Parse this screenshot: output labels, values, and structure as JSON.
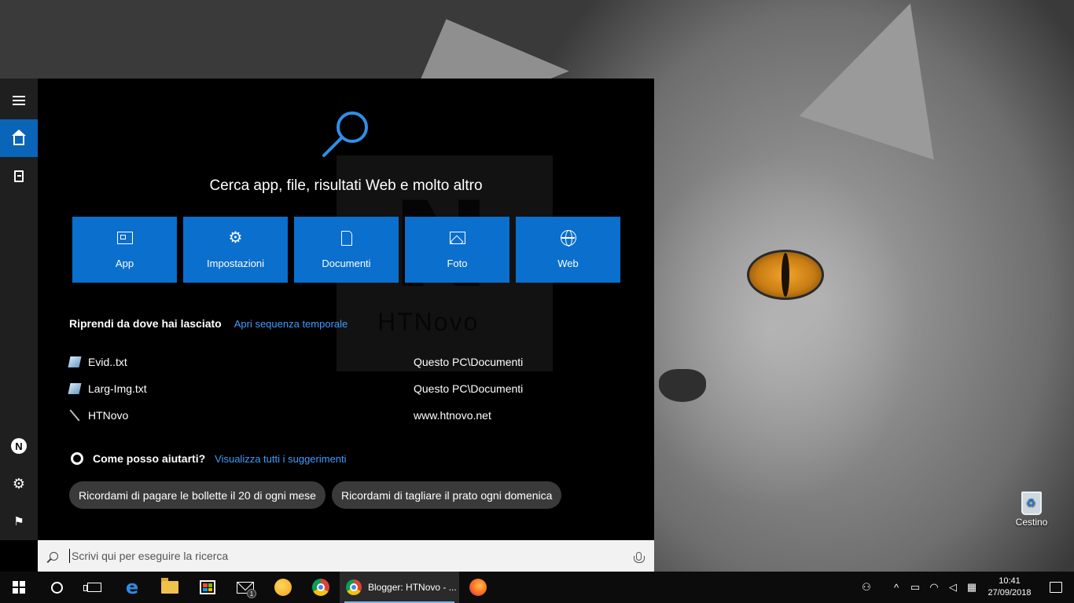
{
  "search": {
    "heading": "Cerca app, file, risultati Web e molto altro",
    "placeholder": "Scrivi qui per eseguire la ricerca"
  },
  "tiles": [
    {
      "label": "App",
      "icon": "app-icon"
    },
    {
      "label": "Impostazioni",
      "icon": "gear-icon"
    },
    {
      "label": "Documenti",
      "icon": "document-icon"
    },
    {
      "label": "Foto",
      "icon": "photo-icon"
    },
    {
      "label": "Web",
      "icon": "globe-icon"
    }
  ],
  "recent": {
    "title": "Riprendi da dove hai lasciato",
    "link": "Apri sequenza temporale",
    "items": [
      {
        "name": "Evid..txt",
        "location": "Questo PC\\Documenti"
      },
      {
        "name": "Larg-Img.txt",
        "location": "Questo PC\\Documenti"
      },
      {
        "name": "HTNovo",
        "location": "www.htnovo.net"
      }
    ]
  },
  "help": {
    "title": "Come posso aiutarti?",
    "link": "Visualizza tutti i suggerimenti",
    "suggestions": [
      "Ricordami di pagare le bollette il 20 di ogni mese",
      "Ricordami di tagliare il prato ogni domenica"
    ]
  },
  "watermark": {
    "letter": "N",
    "text": "HTNovo"
  },
  "rail": {
    "avatar_letter": "N"
  },
  "desktop": {
    "recycle_bin_label": "Cestino"
  },
  "taskbar": {
    "active_window_label": "Blogger: HTNovo - ...",
    "mail_badge": "1",
    "time": "10:41",
    "date": "27/09/2018"
  },
  "colors": {
    "accent": "#0a6fcd",
    "rail_active": "#0a64b8",
    "link": "#3f9bff"
  }
}
